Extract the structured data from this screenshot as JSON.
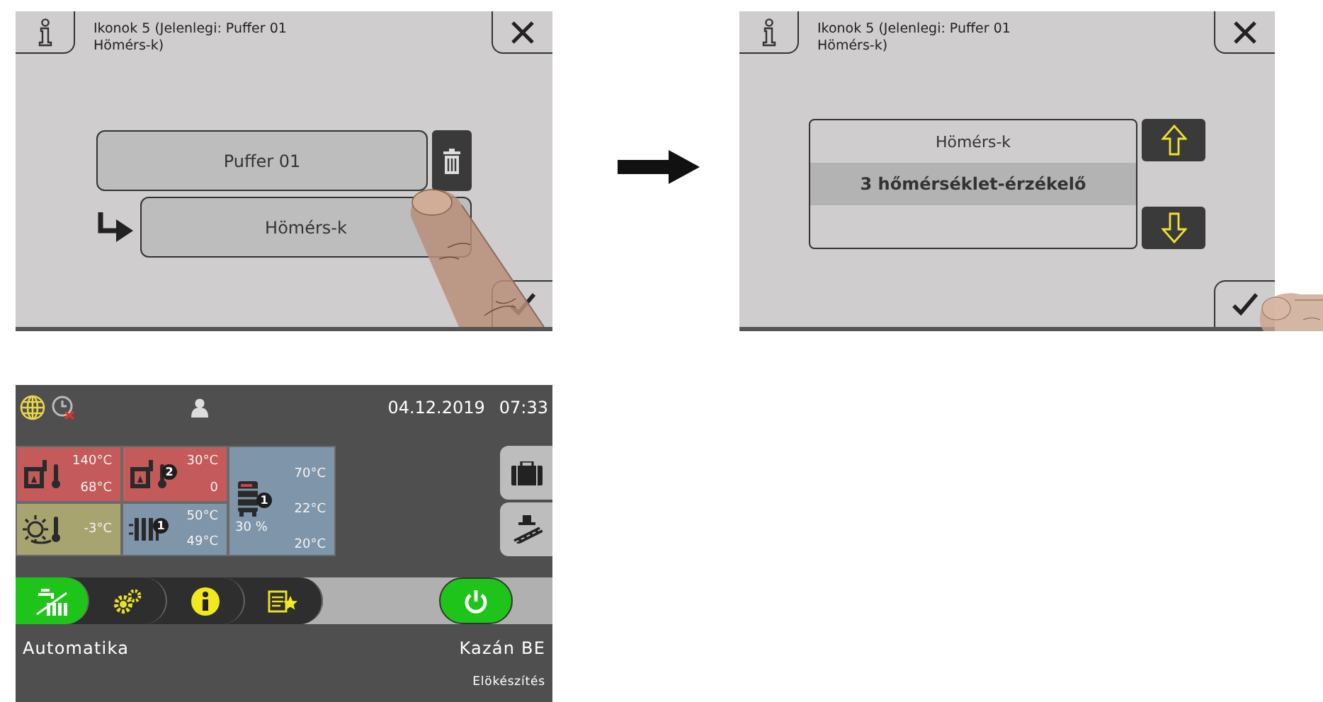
{
  "delete_screen": {
    "title_lines": [
      "Ikonok 5 (Jelenlegi: Puffer 01",
      "Hömérs-k)"
    ],
    "items": [
      {
        "label": "Puffer 01",
        "kind": "parent"
      },
      {
        "label": "Hömérs-k",
        "kind": "child"
      }
    ]
  },
  "select_screen": {
    "title_lines": [
      "Ikonok 5 (Jelenlegi: Puffer 01",
      "Hömérs-k)"
    ],
    "options": [
      {
        "label": "Hömérs-k",
        "selected": false
      },
      {
        "label": "3 hőmérséklet-érzékelő",
        "selected": true
      }
    ]
  },
  "dashboard": {
    "status_bar": {
      "date": "04.12.2019",
      "time": "07:33"
    },
    "tiles": [
      {
        "kind": "boiler",
        "color": "#c45a5a",
        "values": [
          "140°C",
          "68°C"
        ]
      },
      {
        "kind": "boiler",
        "color": "#c45a5a",
        "badge": "2",
        "values": [
          "30°C",
          "0"
        ]
      },
      {
        "kind": "buffer",
        "color": "#7f95aa",
        "badge": "1",
        "percent": "30 %",
        "values": [
          "70°C",
          "22°C",
          "20°C"
        ]
      },
      {
        "kind": "outdoor",
        "color": "#a8a470",
        "values": [
          "-3°C"
        ]
      },
      {
        "kind": "circuit",
        "color": "#7f95aa",
        "badge": "1",
        "values": [
          "50°C",
          "49°C"
        ]
      }
    ],
    "nav": [
      {
        "kind": "mode",
        "selected": true
      },
      {
        "kind": "settings",
        "selected": false
      },
      {
        "kind": "info",
        "selected": false
      },
      {
        "kind": "favorites",
        "selected": false
      }
    ],
    "power": {
      "on": true
    },
    "mode_label": "Automatika",
    "status_label": "Kazán BE",
    "sub_status": "Elökészítés"
  }
}
